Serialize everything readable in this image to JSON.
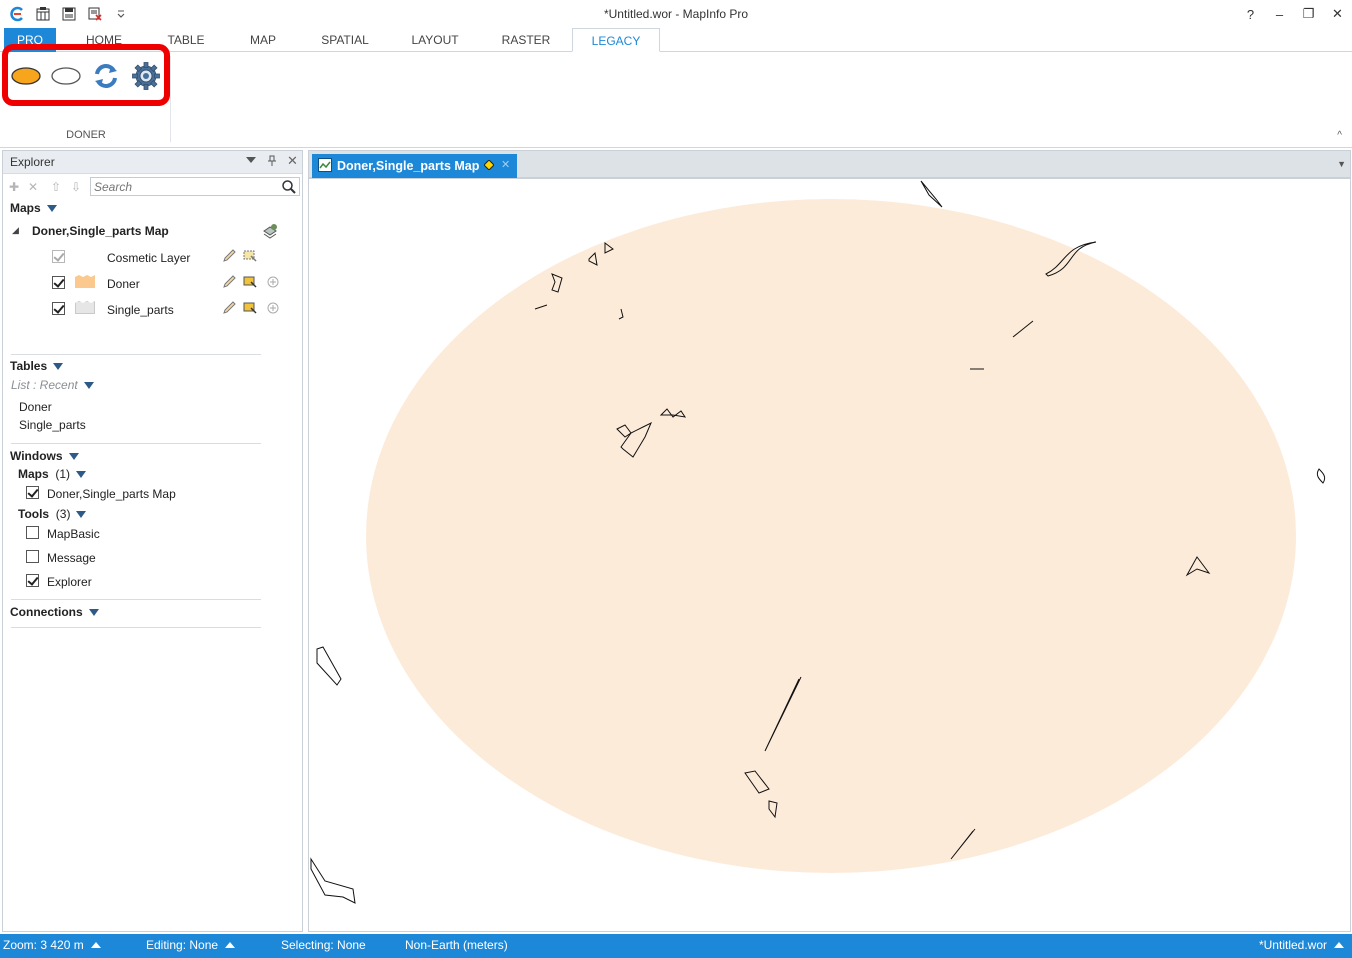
{
  "window": {
    "title": "*Untitled.wor - MapInfo Pro",
    "controls": [
      "?",
      "–",
      "❐",
      "✕"
    ]
  },
  "quick_access": [
    "app-logo-icon",
    "open-workspace-icon",
    "save-icon",
    "close-all-icon",
    "customize-qat-icon"
  ],
  "ribbon": {
    "tabs": [
      {
        "label": "PRO",
        "state": "backstage"
      },
      {
        "label": "HOME"
      },
      {
        "label": "TABLE"
      },
      {
        "label": "MAP"
      },
      {
        "label": "SPATIAL"
      },
      {
        "label": "LAYOUT"
      },
      {
        "label": "RASTER"
      },
      {
        "label": "LEGACY",
        "state": "active"
      }
    ],
    "group_label": "DONER",
    "buttons": [
      "filled-ellipse-icon",
      "empty-ellipse-icon",
      "refresh-icon",
      "settings-gear-icon"
    ],
    "highlight_color": "#ee0000"
  },
  "explorer": {
    "title": "Explorer",
    "search_placeholder": "Search",
    "maps_heading": "Maps",
    "map_name": "Doner,Single_parts Map",
    "layers": [
      {
        "name": "Cosmetic Layer",
        "checked": true,
        "disabled": true
      },
      {
        "name": "Doner",
        "checked": true,
        "swatch": "#fbc98e"
      },
      {
        "name": "Single_parts",
        "checked": true,
        "swatch": "#e6e6e6"
      }
    ],
    "tables_heading": "Tables",
    "list_mode": "List : Recent",
    "tables": [
      "Doner",
      "Single_parts"
    ],
    "windows_heading": "Windows",
    "win_maps_label": "Maps",
    "win_maps_count": "(1)",
    "win_map_item": "Doner,Single_parts Map",
    "tools_label": "Tools",
    "tools_count": "(3)",
    "tools": [
      {
        "name": "MapBasic",
        "checked": false
      },
      {
        "name": "Message",
        "checked": false
      },
      {
        "name": "Explorer",
        "checked": true
      }
    ],
    "connections_heading": "Connections"
  },
  "map_window": {
    "tab_label": "Doner,Single_parts Map",
    "ellipse_fill": "#fdebda"
  },
  "statusbar": {
    "zoom": "Zoom: 3 420 m",
    "editing": "Editing: None",
    "selecting": "Selecting: None",
    "projection": "Non-Earth (meters)",
    "workspace": "*Untitled.wor"
  },
  "colors": {
    "accent": "#1e88d8",
    "doner_fill": "#fbc98e"
  }
}
